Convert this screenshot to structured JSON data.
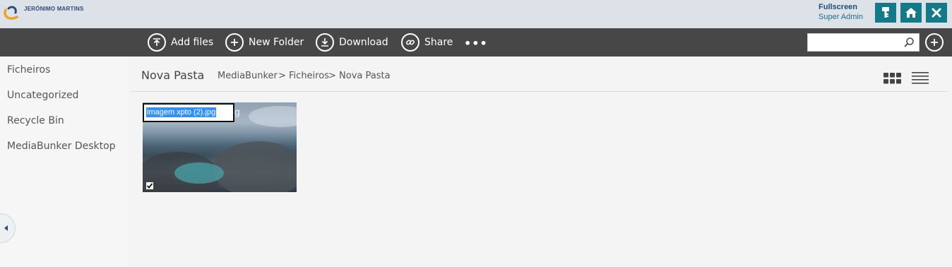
{
  "brand": {
    "name": "JERÓNIMO MARTINS",
    "color_blue": "#2b4a7a",
    "color_orange": "#f0a31c"
  },
  "user": {
    "fullscreen_label": "Fullscreen",
    "role": "Super Admin"
  },
  "header_buttons": [
    {
      "icon": "key-icon"
    },
    {
      "icon": "home-icon"
    },
    {
      "icon": "close-icon"
    }
  ],
  "toolbar": {
    "add_files": "Add files",
    "new_folder": "New Folder",
    "download": "Download",
    "share": "Share",
    "more": "•••",
    "search_placeholder": ""
  },
  "sidebar": {
    "items": [
      {
        "label": "Ficheiros"
      },
      {
        "label": "Uncategorized"
      },
      {
        "label": "Recycle Bin"
      },
      {
        "label": "MediaBunker Desktop"
      }
    ]
  },
  "main": {
    "folder_title": "Nova Pasta",
    "breadcrumb": [
      {
        "label": "MediaBunker"
      },
      {
        "label": "> Ficheiros"
      },
      {
        "label": "> Nova Pasta"
      }
    ]
  },
  "file": {
    "rename_value": "imagem xpto (2).jpg",
    "overlay_suffix": "g",
    "checked": true
  },
  "colors": {
    "toolbar_bg": "#474747",
    "header_bg": "#dde2e9",
    "accent_teal": "#137a8a"
  }
}
